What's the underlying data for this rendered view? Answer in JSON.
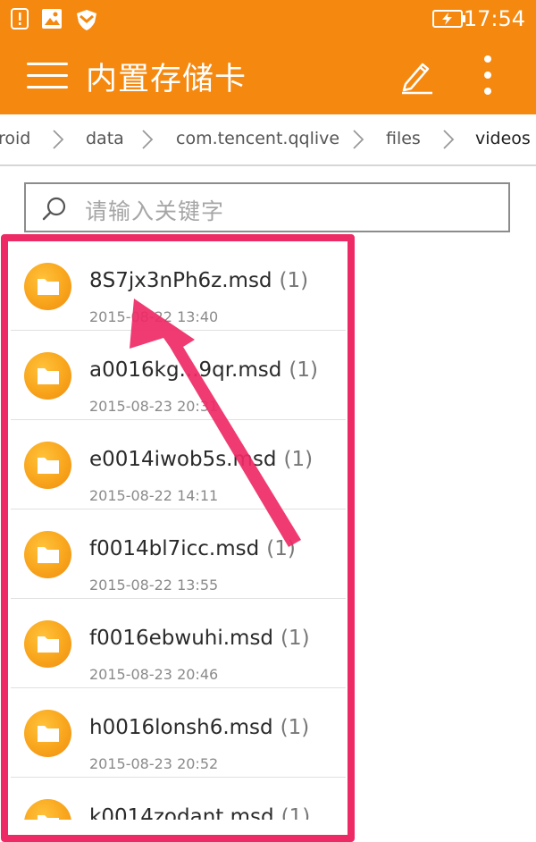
{
  "status_bar": {
    "time": "17:54",
    "icons": [
      "alert-notification-icon",
      "image-notification-icon",
      "shield-notification-icon",
      "battery-charging-icon"
    ]
  },
  "action_bar": {
    "title": "内置存储卡",
    "icons": [
      "hamburger-menu-icon",
      "edit-pencil-icon",
      "overflow-menu-icon"
    ]
  },
  "breadcrumb": {
    "items": [
      "roid",
      "data",
      "com.tencent.qqlive",
      "files",
      "videos"
    ]
  },
  "search": {
    "placeholder": "请输入关键字"
  },
  "files": [
    {
      "name": "8S7jx3nPh6z.msd",
      "count": "(1)",
      "date": "2015-08-22 13:40"
    },
    {
      "name": "a0016kg...9qr.msd",
      "count": "(1)",
      "date": "2015-08-23 20:31"
    },
    {
      "name": "e0014iwob5s.msd",
      "count": "(1)",
      "date": "2015-08-22 14:11"
    },
    {
      "name": "f0014bl7icc.msd",
      "count": "(1)",
      "date": "2015-08-22 13:55"
    },
    {
      "name": "f0016ebwuhi.msd",
      "count": "(1)",
      "date": "2015-08-23 20:46"
    },
    {
      "name": "h0016lonsh6.msd",
      "count": "(1)",
      "date": "2015-08-23 20:52"
    },
    {
      "name": "k0014zodant.msd",
      "count": "(1)",
      "date": ""
    }
  ],
  "colors": {
    "accent": "#f5880f",
    "folder": "#f8a51c",
    "annotation": "#ee2a66"
  }
}
